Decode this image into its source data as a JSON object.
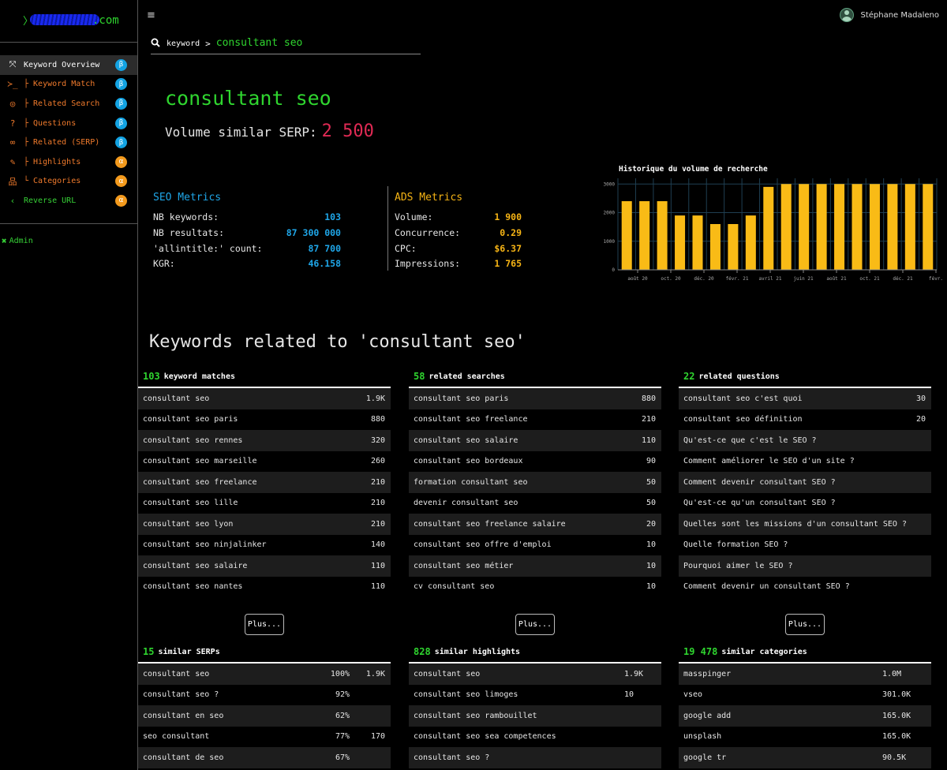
{
  "logo": {
    "prompt": "〉",
    "domain": ".com"
  },
  "nav": {
    "items": [
      {
        "label": "Keyword Overview",
        "badge": "β",
        "icon": "expand-icon",
        "glyph": "⤧"
      },
      {
        "label": "├ Keyword Match",
        "badge": "β",
        "icon": "terminal-icon",
        "glyph": "≻_"
      },
      {
        "label": "├ Related Search",
        "badge": "β",
        "icon": "target-icon",
        "glyph": "◎"
      },
      {
        "label": "├ Questions",
        "badge": "β",
        "icon": "question-circle-icon",
        "glyph": "?"
      },
      {
        "label": "├ Related (SERP)",
        "badge": "β",
        "icon": "link-icon",
        "glyph": "∞"
      },
      {
        "label": "├ Highlights",
        "badge": "α",
        "icon": "highlighter-icon",
        "glyph": "✎"
      },
      {
        "label": "└ Categories",
        "badge": "α",
        "icon": "sitemap-icon",
        "glyph": "品"
      },
      {
        "label": "Reverse URL",
        "badge": "α",
        "icon": "chevron-left-icon",
        "glyph": "‹"
      }
    ],
    "admin": "Admin"
  },
  "header": {
    "user_name": "Stéphane Madaleno",
    "menu_glyph": "≡"
  },
  "search": {
    "crumb": "keyword",
    "separator": ">",
    "query": "consultant seo"
  },
  "keyword": {
    "title": "consultant seo",
    "volume_label": "Volume similar SERP:",
    "volume_value": "2 500"
  },
  "seo_metrics": {
    "title": "SEO Metrics",
    "rows": [
      {
        "label": "NB keywords:",
        "value": "103"
      },
      {
        "label": "NB resultats:",
        "value": "87 300 000"
      },
      {
        "label": "'allintitle:' count:",
        "value": "87 700"
      },
      {
        "label": "KGR:",
        "value": "46.158"
      }
    ]
  },
  "ads_metrics": {
    "title": "ADS Metrics",
    "rows": [
      {
        "label": "Volume:",
        "value": "1 900"
      },
      {
        "label": "Concurrence:",
        "value": "0.29"
      },
      {
        "label": "CPC:",
        "value": "$6.37"
      },
      {
        "label": "Impressions:",
        "value": "1 765"
      }
    ]
  },
  "chart_data": {
    "type": "bar",
    "title": "Historique du volume de recherche",
    "color": "#f9bb16",
    "ylim": [
      0,
      3200
    ],
    "yticks": [
      0,
      1000,
      2000,
      3000
    ],
    "xtick_labels": [
      "août 20",
      "oct. 20",
      "déc. 20",
      "févr. 21",
      "avril 21",
      "juin 21",
      "août 21",
      "oct. 21",
      "déc. 21",
      "févr."
    ],
    "values": [
      2400,
      2400,
      2400,
      1900,
      1900,
      1600,
      1600,
      1900,
      2900,
      3000,
      3000,
      3000,
      3000,
      3000,
      3000,
      3000,
      3000,
      3000
    ],
    "grid": true
  },
  "related_title": "Keywords related to 'consultant seo'",
  "panels": [
    {
      "count": "103",
      "label": "keyword matches",
      "rows": [
        [
          "consultant seo",
          "1.9K"
        ],
        [
          "consultant seo paris",
          "880"
        ],
        [
          "consultant seo rennes",
          "320"
        ],
        [
          "consultant seo marseille",
          "260"
        ],
        [
          "consultant seo freelance",
          "210"
        ],
        [
          "consultant seo lille",
          "210"
        ],
        [
          "consultant seo lyon",
          "210"
        ],
        [
          "consultant seo ninjalinker",
          "140"
        ],
        [
          "consultant seo salaire",
          "110"
        ],
        [
          "consultant seo nantes",
          "110"
        ]
      ],
      "more": "Plus..."
    },
    {
      "count": "58",
      "label": "related searches",
      "rows": [
        [
          "consultant seo paris",
          "880"
        ],
        [
          "consultant seo freelance",
          "210"
        ],
        [
          "consultant seo salaire",
          "110"
        ],
        [
          "consultant seo bordeaux",
          "90"
        ],
        [
          "formation consultant seo",
          "50"
        ],
        [
          "devenir consultant seo",
          "50"
        ],
        [
          "consultant seo freelance salaire",
          "20"
        ],
        [
          "consultant seo offre d'emploi",
          "10"
        ],
        [
          "consultant seo métier",
          "10"
        ],
        [
          "cv consultant seo",
          "10"
        ]
      ],
      "more": "Plus..."
    },
    {
      "count": "22",
      "label": "related questions",
      "rows": [
        [
          "consultant seo c'est quoi",
          "30"
        ],
        [
          "consultant seo définition",
          "20"
        ],
        [
          "Qu'est-ce que c'est le SEO ?",
          ""
        ],
        [
          "Comment améliorer le SEO d'un site ?",
          ""
        ],
        [
          "Comment devenir consultant SEO ?",
          ""
        ],
        [
          "Qu'est-ce qu'un consultant SEO ?",
          ""
        ],
        [
          "Quelles sont les missions d'un consultant SEO ?",
          ""
        ],
        [
          "Quelle formation SEO ?",
          ""
        ],
        [
          "Pourquoi aimer le SEO ?",
          ""
        ],
        [
          "Comment devenir un consultant SEO ?",
          ""
        ]
      ],
      "more": "Plus..."
    },
    {
      "count": "15",
      "label": "similar SERPs",
      "rows": [
        [
          "consultant seo",
          "100%",
          "1.9K"
        ],
        [
          "consultant seo ?",
          "92%",
          ""
        ],
        [
          "consultant en seo",
          "62%",
          ""
        ],
        [
          "seo consultant",
          "77%",
          "170"
        ],
        [
          "consultant de seo",
          "67%",
          ""
        ]
      ]
    },
    {
      "count": "828",
      "label": "similar highlights",
      "rows": [
        [
          "consultant seo",
          "1.9K"
        ],
        [
          "consultant seo limoges",
          "10"
        ],
        [
          "consultant seo rambouillet",
          ""
        ],
        [
          "consultant seo sea competences",
          ""
        ],
        [
          "consultant seo ?",
          ""
        ]
      ]
    },
    {
      "count": "19 478",
      "label": "similar categories",
      "rows": [
        [
          "masspinger",
          "1.0M"
        ],
        [
          "vseo",
          "301.0K"
        ],
        [
          "google add",
          "165.0K"
        ],
        [
          "unsplash",
          "165.0K"
        ],
        [
          "google tr",
          "90.5K"
        ]
      ]
    }
  ]
}
